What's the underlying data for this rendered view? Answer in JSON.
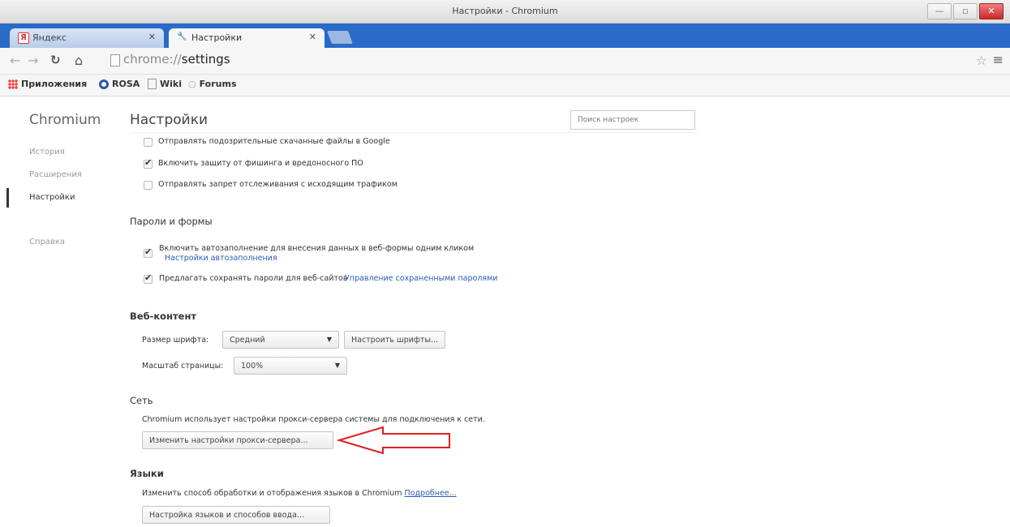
{
  "window": {
    "title": "Настройки - Chromium"
  },
  "tabs": [
    {
      "label": "Яндекс",
      "icon": "yandex-icon"
    },
    {
      "label": "Настройки",
      "icon": "wrench-icon"
    }
  ],
  "toolbar": {
    "url_scheme": "chrome://",
    "url_path": "settings"
  },
  "bookmarks": [
    {
      "label": "Приложения",
      "icon": "apps-icon"
    },
    {
      "label": "ROSA",
      "icon": "rosa-icon"
    },
    {
      "label": "Wiki",
      "icon": "page-icon"
    },
    {
      "label": "Forums",
      "icon": "folder-icon"
    }
  ],
  "sidebar": {
    "title": "Chromium",
    "items": [
      {
        "label": "История"
      },
      {
        "label": "Расширения"
      },
      {
        "label": "Настройки"
      },
      {
        "label": "Справка"
      }
    ]
  },
  "main": {
    "title": "Настройки",
    "search_placeholder": "Поиск настроек",
    "privacy": [
      {
        "label": "Отправлять подозрительные скачанные файлы в Google",
        "checked": false
      },
      {
        "label": "Включить защиту от фишинга и вредоносного ПО",
        "checked": true
      },
      {
        "label": "Отправлять запрет отслеживания с исходящим трафиком",
        "checked": false
      }
    ],
    "passwords": {
      "title": "Пароли и формы",
      "autofill_label": "Включить автозаполнение для внесения данных в веб-формы одним кликом",
      "autofill_link": "Настройки автозаполнения",
      "save_label": "Предлагать сохранять пароли для веб-сайтов",
      "save_link": "Управление сохраненными паролями"
    },
    "webcontent": {
      "title": "Веб-контент",
      "font_size_label": "Размер шрифта:",
      "font_size_value": "Средний",
      "customize_fonts": "Настроить шрифты...",
      "zoom_label": "Масштаб страницы:",
      "zoom_value": "100%"
    },
    "network": {
      "title": "Сеть",
      "description": "Chromium использует настройки прокси-сервера системы для подключения к сети.",
      "proxy_button": "Изменить настройки прокси-сервера..."
    },
    "languages": {
      "title": "Языки",
      "description": "Изменить способ обработки и отображения языков в Chromium",
      "more_link": "Подробнее...",
      "button": "Настройка языков и способов ввода..."
    }
  },
  "colors": {
    "tabstrip": "#2a6ac8",
    "link": "#2a5ab8",
    "annotation_arrow": "#e02020"
  }
}
